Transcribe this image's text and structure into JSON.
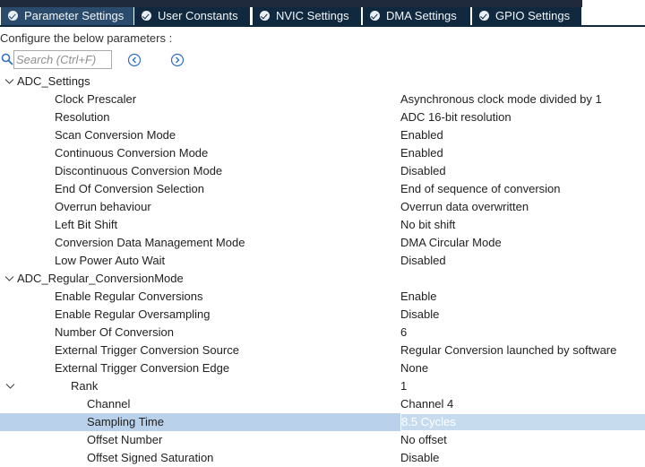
{
  "tabs": [
    {
      "label": "Parameter Settings",
      "active": true
    },
    {
      "label": "User Constants",
      "active": false
    },
    {
      "label": "NVIC Settings",
      "active": false
    },
    {
      "label": "DMA Settings",
      "active": false
    },
    {
      "label": "GPIO Settings",
      "active": false
    }
  ],
  "configure_label": "Configure the below parameters :",
  "search": {
    "placeholder": "Search (Ctrl+F)",
    "value": ""
  },
  "icons": {
    "tab_check": "check-circle-icon",
    "search": "search-icon",
    "prev": "chevron-left-circle-icon",
    "next": "chevron-right-circle-icon",
    "expander": "chevron-down-icon"
  },
  "colors": {
    "tab_bg": "#10293f",
    "tab_active_bg": "#2a4b6b",
    "selected_row": "#b9d1ea",
    "icon_blue": "#2f6fc4"
  },
  "tree": {
    "rows": [
      {
        "level": 0,
        "expandable": true,
        "name": "ADC_Settings",
        "value": ""
      },
      {
        "level": 1,
        "expandable": false,
        "name": "Clock Prescaler",
        "value": "Asynchronous clock mode divided by 1"
      },
      {
        "level": 1,
        "expandable": false,
        "name": "Resolution",
        "value": "ADC 16-bit resolution"
      },
      {
        "level": 1,
        "expandable": false,
        "name": "Scan Conversion Mode",
        "value": "Enabled"
      },
      {
        "level": 1,
        "expandable": false,
        "name": "Continuous Conversion Mode",
        "value": "Enabled"
      },
      {
        "level": 1,
        "expandable": false,
        "name": "Discontinuous Conversion Mode",
        "value": "Disabled"
      },
      {
        "level": 1,
        "expandable": false,
        "name": "End Of Conversion Selection",
        "value": "End of sequence of conversion"
      },
      {
        "level": 1,
        "expandable": false,
        "name": "Overrun behaviour",
        "value": "Overrun data overwritten"
      },
      {
        "level": 1,
        "expandable": false,
        "name": "Left Bit Shift",
        "value": "No bit shift"
      },
      {
        "level": 1,
        "expandable": false,
        "name": "Conversion Data Management Mode",
        "value": "DMA Circular Mode"
      },
      {
        "level": 1,
        "expandable": false,
        "name": "Low Power Auto Wait",
        "value": "Disabled"
      },
      {
        "level": 0,
        "expandable": true,
        "name": "ADC_Regular_ConversionMode",
        "value": ""
      },
      {
        "level": 1,
        "expandable": false,
        "name": "Enable Regular Conversions",
        "value": "Enable"
      },
      {
        "level": 1,
        "expandable": false,
        "name": "Enable Regular Oversampling",
        "value": "Disable"
      },
      {
        "level": 1,
        "expandable": false,
        "name": "Number Of Conversion",
        "value": "6"
      },
      {
        "level": 1,
        "expandable": false,
        "name": "External Trigger Conversion Source",
        "value": "Regular Conversion launched by software"
      },
      {
        "level": 1,
        "expandable": false,
        "name": "External Trigger Conversion Edge",
        "value": "None"
      },
      {
        "level": 2,
        "expandable": true,
        "name": "Rank",
        "value": "1"
      },
      {
        "level": 3,
        "expandable": false,
        "name": "Channel",
        "value": "Channel 4"
      },
      {
        "level": 3,
        "expandable": false,
        "name": "Sampling Time",
        "value": "8.5 Cycles",
        "selected": true
      },
      {
        "level": 3,
        "expandable": false,
        "name": "Offset Number",
        "value": "No offset"
      },
      {
        "level": 3,
        "expandable": false,
        "name": "Offset Signed Saturation",
        "value": "Disable"
      }
    ]
  }
}
